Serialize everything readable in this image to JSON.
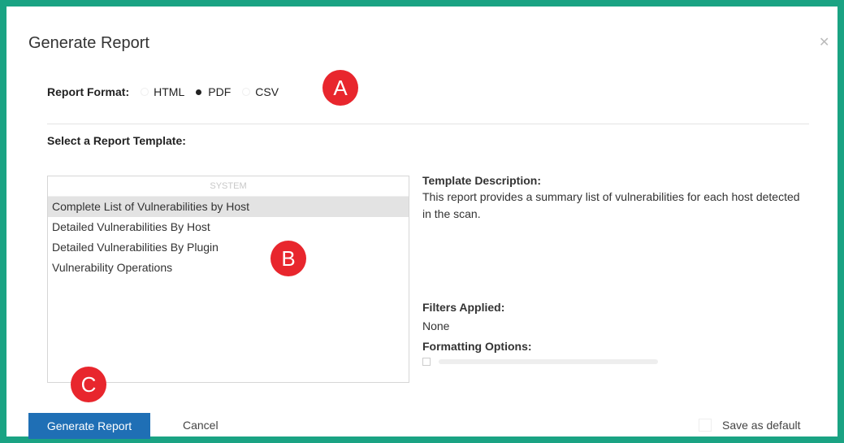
{
  "dialog": {
    "title": "Generate Report",
    "close_glyph": "✕"
  },
  "report_format": {
    "label": "Report Format:",
    "options": [
      {
        "label": "HTML",
        "selected": false
      },
      {
        "label": "PDF",
        "selected": true
      },
      {
        "label": "CSV",
        "selected": false
      }
    ]
  },
  "template_section": {
    "label": "Select a Report Template:",
    "group_header": "SYSTEM",
    "items": [
      {
        "label": "Complete List of Vulnerabilities by Host",
        "selected": true
      },
      {
        "label": "Detailed Vulnerabilities By Host",
        "selected": false
      },
      {
        "label": "Detailed Vulnerabilities By Plugin",
        "selected": false
      },
      {
        "label": "Vulnerability Operations",
        "selected": false
      }
    ]
  },
  "template_description": {
    "heading": "Template Description:",
    "text": "This report provides a summary list of vulnerabilities for each host detected in the scan."
  },
  "filters": {
    "heading": "Filters Applied:",
    "value": "None"
  },
  "formatting": {
    "heading": "Formatting Options:"
  },
  "footer": {
    "generate_label": "Generate Report",
    "cancel_label": "Cancel",
    "save_default_label": "Save as default"
  },
  "annotations": {
    "a": "A",
    "b": "B",
    "c": "C"
  },
  "colors": {
    "frame_border": "#1aa383",
    "primary_button": "#1f6fb5",
    "marker": "#e8262d"
  }
}
